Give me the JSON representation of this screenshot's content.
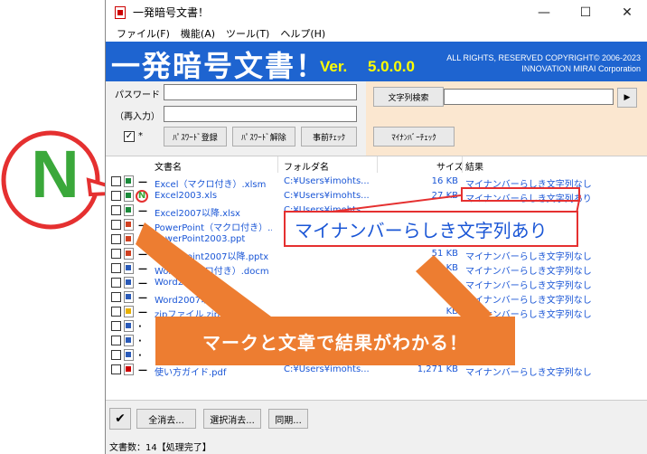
{
  "window": {
    "title": "一発暗号文書！",
    "controls": {
      "minimize": "—",
      "maximize": "☐",
      "close": "✕"
    }
  },
  "menu": [
    "ファイル(F)",
    "機能(A)",
    "ツール(T)",
    "ヘルプ(H)"
  ],
  "banner": {
    "title": "一発暗号文書！",
    "ver_label": "Ver.",
    "version": "5.0.0.0",
    "copyright_line1": "ALL RIGHTS, RESERVED COPYRIGHT© 2006-2023",
    "copyright_line2": "INNOVATION MIRAI Corporation"
  },
  "left_panel": {
    "password_label": "パスワード",
    "reenter_label": "（再入力）",
    "show_checkbox_label": "*",
    "register_button": "ﾊﾟｽﾜｰﾄﾞ登録",
    "remove_button": "ﾊﾟｽﾜｰﾄﾞ解除",
    "precheck_button": "事前ﾁｪｯｸ"
  },
  "right_panel": {
    "search_button": "文字列検索",
    "go_button": "▶",
    "mynumber_button": "ﾏｲﾅﾝﾊﾞｰﾁｪｯｸ"
  },
  "list": {
    "headers": {
      "name": "文書名",
      "folder": "フォルダ名",
      "size": "サイズ",
      "result": "結果"
    },
    "rows": [
      {
        "icon": "green",
        "mark": "—",
        "name": "Excel（マクロ付き）.xlsm",
        "folder": "C:¥Users¥imohts...",
        "size": "16 KB",
        "result": "マイナンバーらしき文字列なし"
      },
      {
        "icon": "green",
        "mark": "N",
        "name": "Excel2003.xls",
        "folder": "C:¥Users¥imohts...",
        "size": "27 KB",
        "result": "マイナンバーらしき文字列あり"
      },
      {
        "icon": "green",
        "mark": "—",
        "name": "Excel2007以降.xlsx",
        "folder": "C:¥Users¥imohts...",
        "size": "",
        "result": ""
      },
      {
        "icon": "red",
        "mark": "—",
        "name": "PowerPoint（マクロ付き）....",
        "folder": "",
        "size": "",
        "result": ""
      },
      {
        "icon": "red",
        "mark": "—",
        "name": "PowerPoint2003.ppt",
        "folder": "",
        "size": "",
        "result": ""
      },
      {
        "icon": "red",
        "mark": "—",
        "name": "PowerPoint2007以降.pptx",
        "folder": "",
        "size": "51 KB",
        "result": "マイナンバーらしき文字列なし"
      },
      {
        "icon": "blue",
        "mark": "—",
        "name": "Word（マクロ付き）.docm",
        "folder": "",
        "size": "KB",
        "result": "マイナンバーらしき文字列なし"
      },
      {
        "icon": "blue",
        "mark": "—",
        "name": "Word2003.doc",
        "folder": "",
        "size": "KB",
        "result": "マイナンバーらしき文字列なし"
      },
      {
        "icon": "blue",
        "mark": "—",
        "name": "Word2007以降.docx",
        "folder": "",
        "size": "KB",
        "result": "マイナンバーらしき文字列なし"
      },
      {
        "icon": "yellow",
        "mark": "—",
        "name": "zipファイル.zip",
        "folder": "",
        "size": "KB",
        "result": "マイナンバーらしき文字列なし"
      },
      {
        "icon": "blue",
        "mark": "·",
        "name": "",
        "folder": "",
        "size": "",
        "result": ""
      },
      {
        "icon": "blue",
        "mark": "·",
        "name": "",
        "folder": "",
        "size": "",
        "result": ""
      },
      {
        "icon": "blue",
        "mark": "·",
        "name": "",
        "folder": "",
        "size": "",
        "result": ""
      },
      {
        "icon": "pdf",
        "mark": "—",
        "name": "使い方ガイド.pdf",
        "folder": "C:¥Users¥imohts...",
        "size": "1,271 KB",
        "result": "マイナンバーらしき文字列なし"
      }
    ]
  },
  "bottom": {
    "check_icon": "✔",
    "clear_all_button": "全消去...",
    "clear_selected_button": "選択消去...",
    "sync_button": "同期..."
  },
  "status": "文書数：14【処理完了】",
  "overlay": {
    "n_letter": "N",
    "callout_text": "マイナンバーらしき文字列あり",
    "banner_text": "マークと文章で結果がわかる！"
  },
  "colors": {
    "banner_blue": "#1e64d0",
    "accent_orange": "#ed7d31",
    "alert_red": "#e53030",
    "link_blue": "#1a56d6"
  }
}
